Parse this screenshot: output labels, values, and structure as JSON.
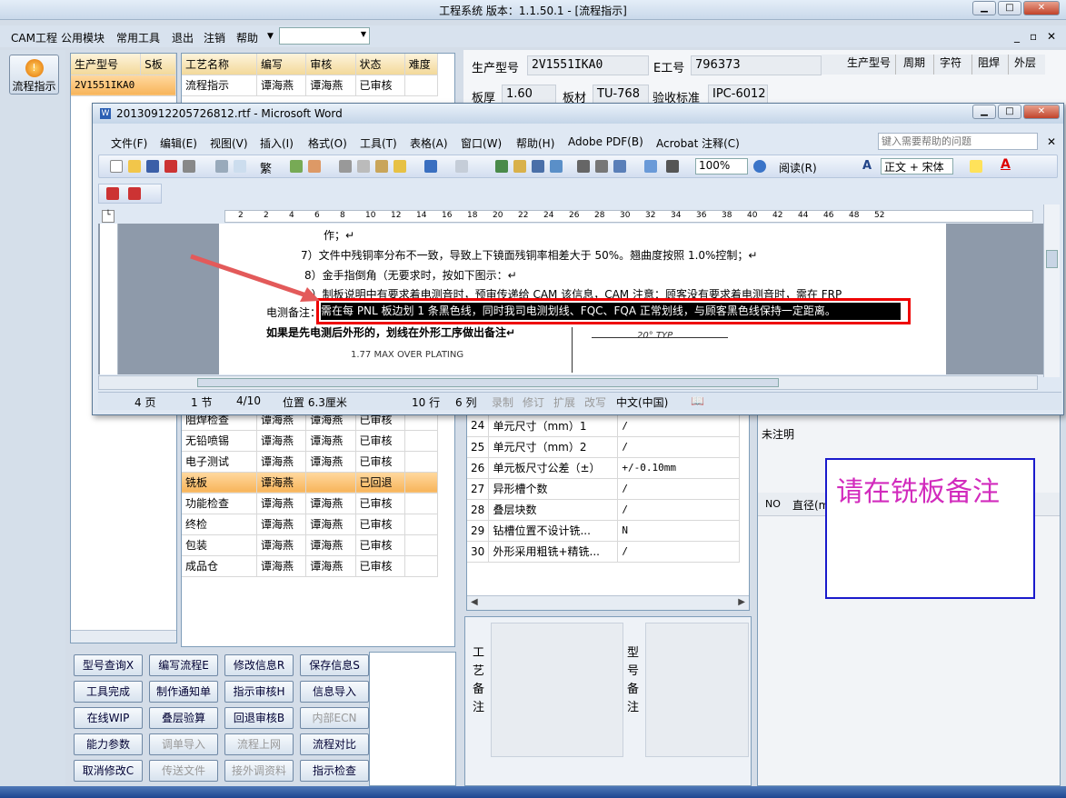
{
  "app_title": "工程系统   版本：1.1.50.1 - [流程指示]",
  "menubar": [
    "CAM工程",
    "公用模块",
    "常用工具",
    "退出",
    "注销",
    "帮助"
  ],
  "flow_button": "流程指示",
  "model_table": {
    "headers": [
      "生产型号",
      "S板"
    ],
    "rows": [
      [
        "2V1551IKA0",
        ""
      ]
    ]
  },
  "process_table": {
    "headers": [
      "工艺名称",
      "编写",
      "审核",
      "状态",
      "难度"
    ],
    "rows_top": [
      [
        "流程指示",
        "谭海燕",
        "谭海燕",
        "已审核",
        ""
      ]
    ],
    "rows_bottom": [
      [
        "阻焊检查",
        "谭海燕",
        "谭海燕",
        "已审核",
        ""
      ],
      [
        "无铅喷锡",
        "谭海燕",
        "谭海燕",
        "已审核",
        ""
      ],
      [
        "电子测试",
        "谭海燕",
        "谭海燕",
        "已审核",
        ""
      ],
      [
        "铣板",
        "谭海燕",
        "",
        "已回退",
        ""
      ],
      [
        "功能检查",
        "谭海燕",
        "谭海燕",
        "已审核",
        ""
      ],
      [
        "终检",
        "谭海燕",
        "谭海燕",
        "已审核",
        ""
      ],
      [
        "包装",
        "谭海燕",
        "谭海燕",
        "已审核",
        ""
      ],
      [
        "成品仓",
        "谭海燕",
        "谭海燕",
        "已审核",
        ""
      ]
    ]
  },
  "buttons": [
    [
      "型号查询X",
      "编写流程E",
      "修改信息R",
      "保存信息S"
    ],
    [
      "工具完成",
      "制作通知单",
      "指示审核H",
      "信息导入"
    ],
    [
      "在线WIP",
      "叠层验算",
      "回退审核B",
      "内部ECN"
    ],
    [
      "能力参数",
      "调单导入",
      "流程上网",
      "流程对比"
    ],
    [
      "取消修改C",
      "传送文件",
      "接外调资料",
      "指示检查"
    ]
  ],
  "info": {
    "model_label": "生产型号",
    "model_value": "2V1551IKA0",
    "e_label": "E工号",
    "e_value": "796373",
    "thick_label": "板厚",
    "thick_value": "1.60",
    "material_label": "板材",
    "material_value": "TU-768",
    "standard_label": "验收标准",
    "standard_value": "IPC-6012"
  },
  "right_headers": [
    "生产型号",
    "周期",
    "字符",
    "阻焊",
    "外层"
  ],
  "param_table": [
    [
      "24",
      "单元尺寸（mm）1",
      "/"
    ],
    [
      "25",
      "单元尺寸（mm）2",
      "/"
    ],
    [
      "26",
      "单元板尺寸公差（±）",
      "+/-0.10mm"
    ],
    [
      "27",
      "异形槽个数",
      "/"
    ],
    [
      "28",
      "叠层块数",
      "/"
    ],
    [
      "29",
      "钻槽位置不设计铣...",
      "N"
    ],
    [
      "30",
      "外形采用粗铣+精铣...",
      "/"
    ]
  ],
  "memo": {
    "craft": "工艺备注",
    "model": "型号备注"
  },
  "right_small": {
    "unmarked": "未注明",
    "no": "NO",
    "diameter": "直径(m"
  },
  "word": {
    "title": "20130912205726812.rtf - Microsoft Word",
    "menu": [
      "文件(F)",
      "编辑(E)",
      "视图(V)",
      "插入(I)",
      "格式(O)",
      "工具(T)",
      "表格(A)",
      "窗口(W)",
      "帮助(H)",
      "Adobe PDF(B)",
      "Acrobat 注释(C)"
    ],
    "help_placeholder": "键入需要帮助的问题",
    "zoom": "100%",
    "read": "阅读(R)",
    "style": "正文 + 宋体",
    "ruler_nums": [
      "2",
      "2",
      "4",
      "6",
      "8",
      "10",
      "12",
      "14",
      "16",
      "18",
      "20",
      "22",
      "24",
      "26",
      "28",
      "30",
      "32",
      "34",
      "36",
      "38",
      "40",
      "42",
      "44",
      "46",
      "48",
      "52"
    ],
    "lines": [
      "作；↵",
      "7）文件中残铜率分布不一致，导致上下镜面残铜率相差大于 50%。翘曲度按照 1.0%控制；↵",
      "8）金手指倒角（无要求时，按如下图示：↵",
      "9）制板说明中有要求着电测音时，预审传递给 CAM 该信息，CAM 注意：顾客没有要求着电测音时，需在 FRP",
      "电测备注：",
      "需在每 PNL 板边划 1 条黑色线，同时我司电测划线、FQC、FQA 正常划线，与顾客黑色线保持一定距离。",
      "如果是先电测后外形的，划线在外形工序做出备注↵",
      "1.77 MAX OVER PLATING",
      "20° TYP"
    ],
    "status": [
      "4 页",
      "1 节",
      "4/10",
      "位置 6.3厘米",
      "10 行",
      "6 列",
      "录制",
      "修订",
      "扩展",
      "改写",
      "中文(中国)"
    ]
  },
  "annotation": "请在铣板备注",
  "colors": {
    "accent": "#f7b45a",
    "red_box": "#e00000",
    "note_text": "#d22bbd",
    "note_border": "#1a1acc"
  }
}
